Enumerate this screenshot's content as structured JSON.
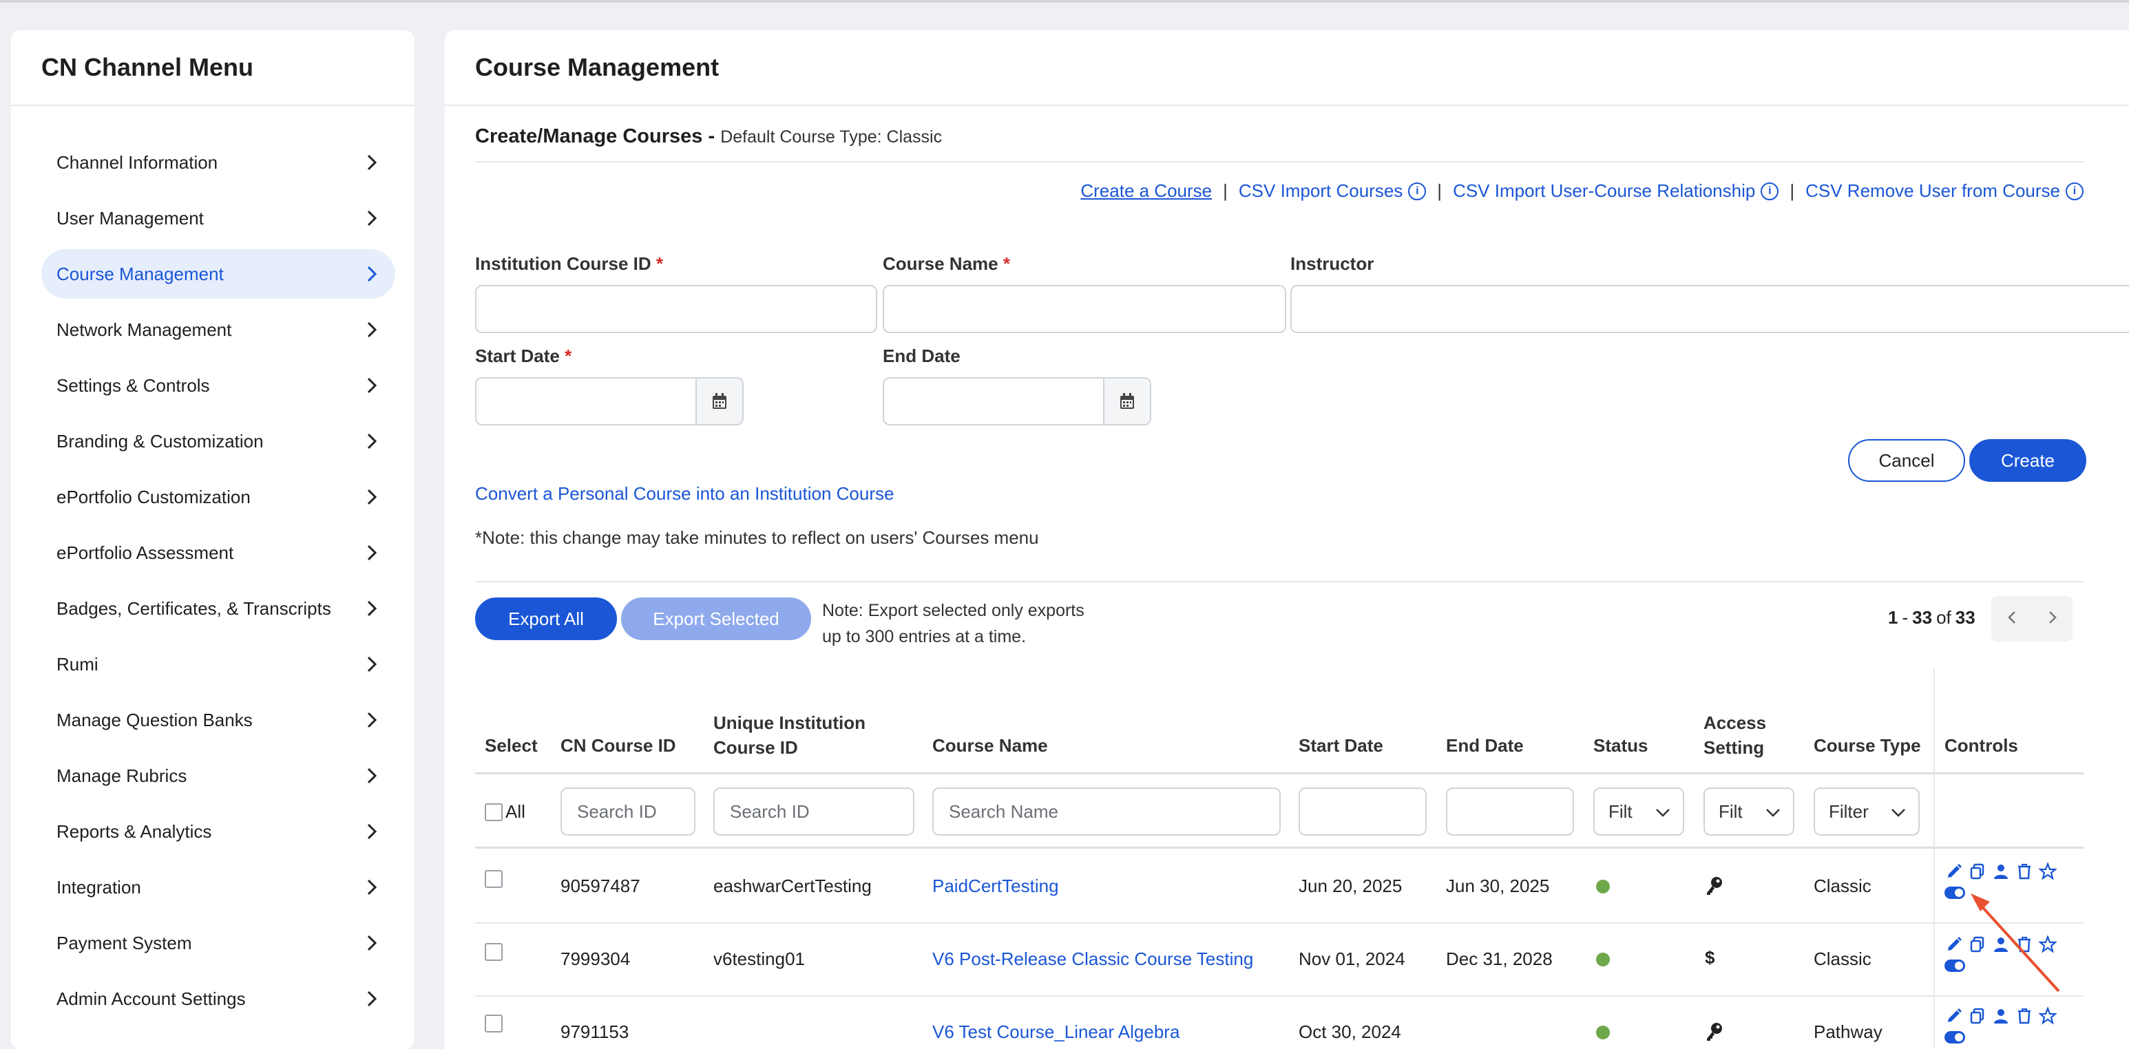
{
  "sidebar": {
    "title": "CN Channel Menu",
    "items": [
      {
        "label": "Channel Information"
      },
      {
        "label": "User Management"
      },
      {
        "label": "Course Management"
      },
      {
        "label": "Network Management"
      },
      {
        "label": "Settings & Controls"
      },
      {
        "label": "Branding & Customization"
      },
      {
        "label": "ePortfolio Customization"
      },
      {
        "label": "ePortfolio Assessment"
      },
      {
        "label": "Badges, Certificates, & Transcripts"
      },
      {
        "label": "Rumi"
      },
      {
        "label": "Manage Question Banks"
      },
      {
        "label": "Manage Rubrics"
      },
      {
        "label": "Reports & Analytics"
      },
      {
        "label": "Integration"
      },
      {
        "label": "Payment System"
      },
      {
        "label": "Admin Account Settings"
      }
    ],
    "active_item": "Course Management"
  },
  "main": {
    "title": "Course Management",
    "section_title": "Create/Manage Courses -",
    "section_subtitle": "Default Course Type: Classic",
    "links": {
      "create": "Create a Course",
      "csv_import": "CSV Import Courses",
      "csv_relationship": "CSV Import User-Course Relationship",
      "csv_remove": "CSV Remove User from Course",
      "sep": "|"
    },
    "form": {
      "institution_id_label": "Institution Course ID",
      "course_name_label": "Course Name",
      "instructor_label": "Instructor",
      "start_date_label": "Start Date",
      "end_date_label": "End Date",
      "required_mark": "*",
      "cancel": "Cancel",
      "create": "Create"
    },
    "convert_link": "Convert a Personal Course into an Institution Course",
    "note": "*Note: this change may take minutes to reflect on users' Courses menu",
    "export": {
      "all": "Export All",
      "selected": "Export Selected",
      "note_line1": "Note: Export selected only exports",
      "note_line2": "up to 300 entries at a time."
    },
    "pager": {
      "from": "1",
      "dash": "-",
      "to": "33",
      "of": "of",
      "total": "33"
    },
    "table": {
      "headers": {
        "select": "Select",
        "cn_id": "CN Course ID",
        "unique_id_1": "Unique Institution",
        "unique_id_2": "Course ID",
        "name": "Course Name",
        "start": "Start Date",
        "end": "End Date",
        "status": "Status",
        "access_1": "Access",
        "access_2": "Setting",
        "type": "Course Type",
        "controls": "Controls"
      },
      "filters": {
        "all": "All",
        "search_id": "Search ID",
        "search_unique": "Search ID",
        "search_name": "Search Name",
        "status": "Filt",
        "access": "Filt",
        "type": "Filter"
      },
      "rows": [
        {
          "cn_id": "90597487",
          "unique_id": "eashwarCertTesting",
          "name": "PaidCertTesting",
          "start": "Jun 20, 2025",
          "end": "Jun 30, 2025",
          "access_icon": "key-icon",
          "type": "Classic"
        },
        {
          "cn_id": "7999304",
          "unique_id": "v6testing01",
          "name": "V6 Post-Release Classic Course Testing",
          "start": "Nov 01, 2024",
          "end": "Dec 31, 2028",
          "access_icon": "dollar-icon",
          "access_text": "$",
          "type": "Classic"
        },
        {
          "cn_id": "9791153",
          "unique_id": "",
          "name": "V6 Test Course_Linear Algebra",
          "start": "Oct 30, 2024",
          "end": "",
          "access_icon": "key-icon",
          "type": "Pathway"
        }
      ]
    }
  },
  "colors": {
    "accent": "#1a56d6",
    "status_active": "#6fa84a",
    "annotation_arrow": "#e8502f"
  }
}
